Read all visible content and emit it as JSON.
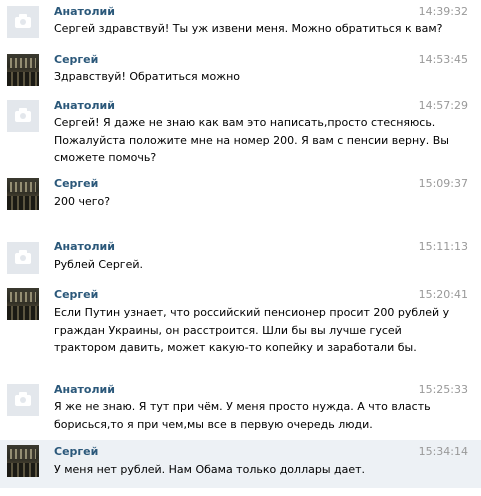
{
  "messages": [
    {
      "author": "Анатолий",
      "time": "14:39:32",
      "avatar": "camera-icon",
      "lines": [
        "Сергей здравствуй! Ты уж извени меня. Можно обратиться к вам?"
      ]
    },
    {
      "author": "Сергей",
      "time": "14:53:45",
      "avatar": "user-photo",
      "lines": [
        "Здравствуй! Обратиться можно"
      ]
    },
    {
      "author": "Анатолий",
      "time": "14:57:29",
      "avatar": "camera-icon",
      "lines": [
        "Сергей! Я даже не знаю как вам это написать,просто стесняюсь.",
        "Пожалуйста положите мне на номер 200. Я вам с пенсии верну. Вы",
        "сможете помочь?"
      ]
    },
    {
      "author": "Сергей",
      "time": "15:09:37",
      "avatar": "user-photo",
      "lines": [
        "200 чего?"
      ]
    },
    {
      "author": "Анатолий",
      "time": "15:11:13",
      "avatar": "camera-icon",
      "lines": [
        "Рублей Сергей."
      ]
    },
    {
      "author": "Сергей",
      "time": "15:20:41",
      "avatar": "user-photo",
      "lines": [
        "Если Путин узнает, что российский пенсионер просит 200 рублей у",
        "граждан Украины, он расстроится. Шли бы вы лучше гусей",
        "трактором давить, может какую-то копейку и заработали бы."
      ]
    },
    {
      "author": "Анатолий",
      "time": "15:25:33",
      "avatar": "camera-icon",
      "lines": [
        "Я же не знаю. Я тут при чём. У меня просто нужда. А что власть",
        "борисься,то я при чем,мы все в первую очередь люди."
      ]
    },
    {
      "author": "Сергей",
      "time": "15:34:14",
      "avatar": "user-photo",
      "lines": [
        "У меня нет рублей. Нам Обама только доллары дает."
      ]
    }
  ]
}
